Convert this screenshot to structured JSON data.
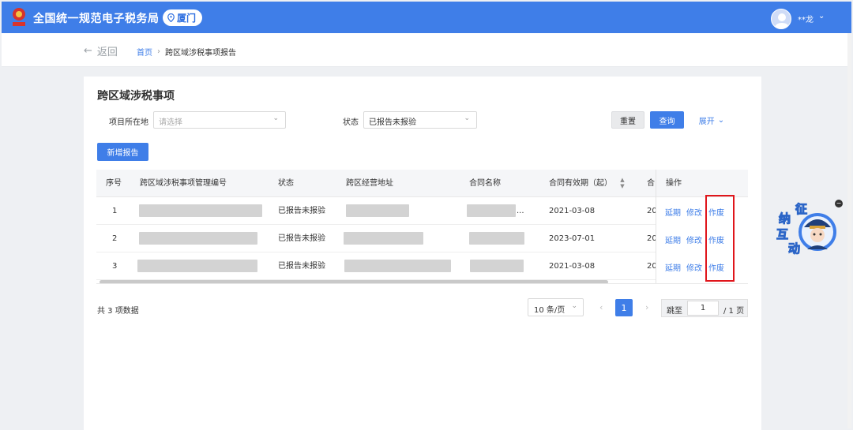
{
  "header": {
    "site_title": "全国统一规范电子税务局",
    "city": "厦门",
    "user_name": "**龙"
  },
  "breadcrumb": {
    "back_label": "返回",
    "home": "首页",
    "separator": "›",
    "current": "跨区域涉税事项报告"
  },
  "page": {
    "title": "跨区域涉税事项",
    "filters": {
      "location_label": "项目所在地",
      "location_placeholder": "请选择",
      "status_label": "状态",
      "status_value": "已报告未报验"
    },
    "buttons": {
      "reset": "重置",
      "query": "查询",
      "expand": "展开",
      "add": "新增报告"
    }
  },
  "table": {
    "columns": [
      "序号",
      "跨区域涉税事项管理编号",
      "状态",
      "跨区经营地址",
      "合同名称",
      "合同有效期（起）",
      "合",
      "操作"
    ],
    "rows": [
      {
        "index": "1",
        "status": "已报告未报验",
        "contract_start": "2021-03-08",
        "next_col": "20",
        "contract_name_suffix": "..."
      },
      {
        "index": "2",
        "status": "已报告未报验",
        "contract_start": "2023-07-01",
        "next_col": "20",
        "contract_name_suffix": ""
      },
      {
        "index": "3",
        "status": "已报告未报验",
        "contract_start": "2021-03-08",
        "next_col": "20",
        "contract_name_suffix": ""
      }
    ],
    "actions": [
      "延期",
      "修改",
      "作废"
    ]
  },
  "footer": {
    "total": "共 3 项数据",
    "page_size": "10 条/页",
    "current_page": "1",
    "jump_label": "跳至",
    "jump_value": "1",
    "total_pages": "/ 1 页"
  },
  "mascot": {
    "chars": [
      "征",
      "纳",
      "互",
      "动"
    ]
  },
  "colors": {
    "primary": "#3f7ee8",
    "highlight": "#e0151b"
  }
}
